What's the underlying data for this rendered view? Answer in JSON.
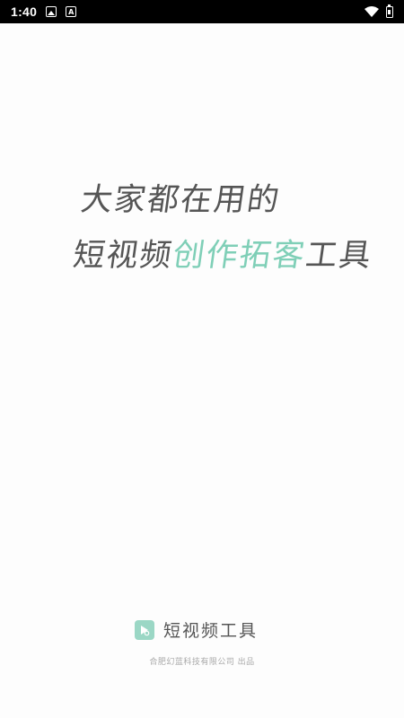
{
  "status_bar": {
    "time": "1:40",
    "icons": [
      "image-icon",
      "a-icon",
      "wifi-icon",
      "battery-icon"
    ]
  },
  "slogan": {
    "line1": "大家都在用的",
    "line2_prefix": "短视频",
    "line2_accent": "创作拓客",
    "line2_suffix": "工具"
  },
  "brand": {
    "name": "短视频工具",
    "logo_icon": "play-logo-icon"
  },
  "company": {
    "text": "合肥幻蓝科技有限公司 出品"
  },
  "colors": {
    "accent": "#7fcfb7",
    "text": "#555555",
    "logo_bg": "#9bd7c5",
    "muted": "#a9a9a9"
  }
}
